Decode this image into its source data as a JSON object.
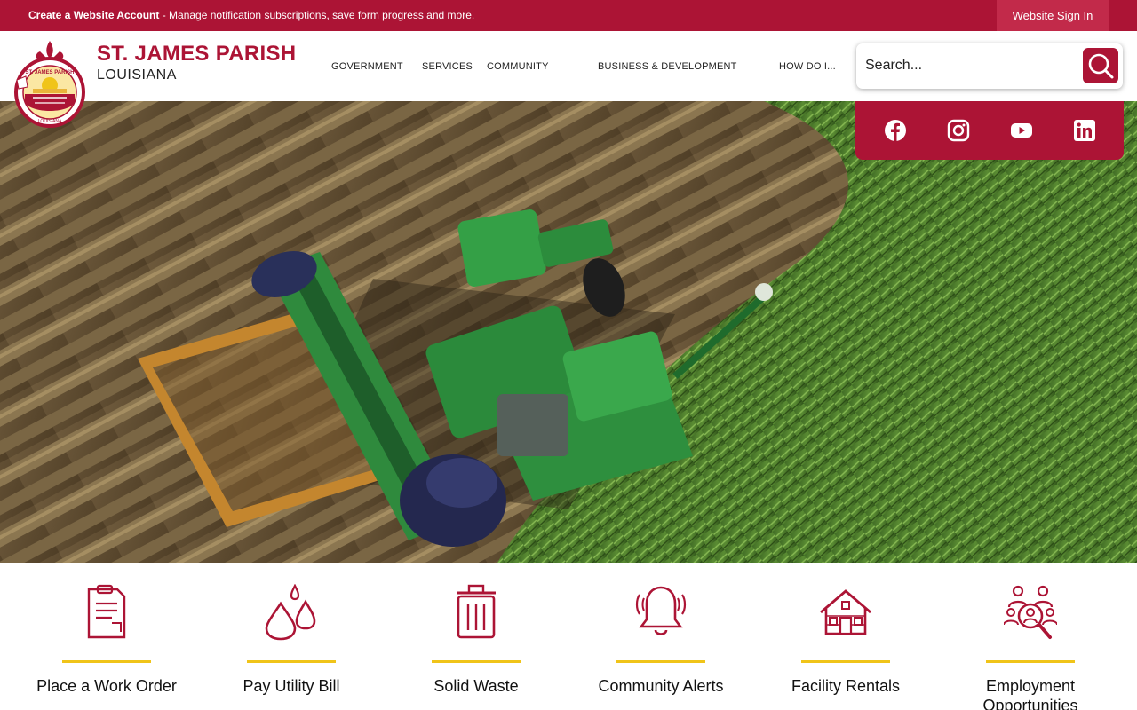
{
  "topbar": {
    "create_account": "Create a Website Account",
    "message": " - Manage notification subscriptions, save form progress and more.",
    "sign_in": "Website Sign In"
  },
  "brand": {
    "name": "ST. JAMES PARISH",
    "subtitle": "LOUISIANA",
    "seal_text_top": "ST. JAMES PARISH",
    "seal_text_bottom": "LOUISIANA"
  },
  "nav": {
    "items": [
      "GOVERNMENT",
      "SERVICES",
      "COMMUNITY",
      "BUSINESS & DEVELOPMENT",
      "HOW DO I..."
    ]
  },
  "search": {
    "placeholder": "Search...",
    "icon": "search-icon"
  },
  "social": {
    "items": [
      "facebook-icon",
      "instagram-icon",
      "youtube-icon",
      "linkedin-icon"
    ]
  },
  "quick_links": {
    "items": [
      {
        "label": "Place a Work Order",
        "icon": "clipboard-icon"
      },
      {
        "label": "Pay Utility Bill",
        "icon": "water-drops-icon"
      },
      {
        "label": "Solid Waste",
        "icon": "trash-can-icon"
      },
      {
        "label": "Community Alerts",
        "icon": "bell-icon"
      },
      {
        "label": "Facility Rentals",
        "icon": "cabin-icon"
      },
      {
        "label": "Employment Opportunities",
        "icon": "people-search-icon"
      }
    ]
  },
  "colors": {
    "brand_red": "#ac1435",
    "accent_yellow": "#f0c419"
  }
}
